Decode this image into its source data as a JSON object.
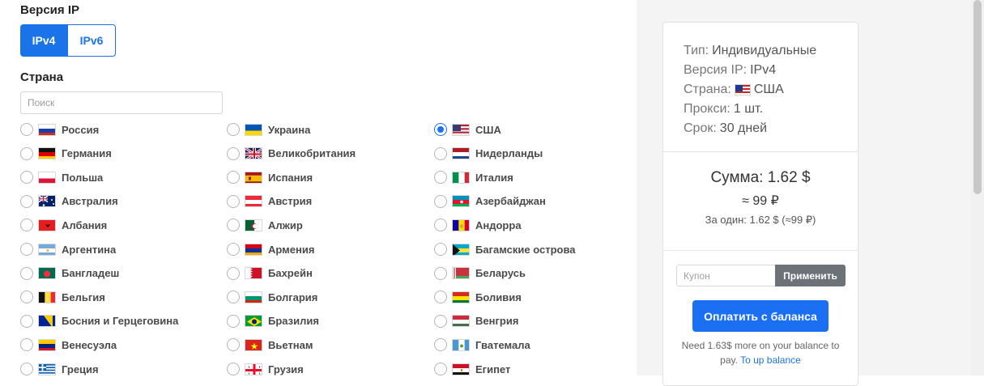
{
  "ip_version": {
    "label": "Версия IP",
    "options": [
      "IPv4",
      "IPv6"
    ],
    "selected": "IPv4"
  },
  "country_section": {
    "label": "Страна",
    "search_placeholder": "Поиск",
    "selected": "США"
  },
  "countries": [
    [
      "Россия",
      "Германия",
      "Польша",
      "Австралия",
      "Албания",
      "Аргентина",
      "Бангладеш",
      "Бельгия",
      "Босния и Герцеговина",
      "Венесуэла",
      "Греция"
    ],
    [
      "Украина",
      "Великобритания",
      "Испания",
      "Австрия",
      "Алжир",
      "Армения",
      "Бахрейн",
      "Болгария",
      "Бразилия",
      "Вьетнам",
      "Грузия"
    ],
    [
      "США",
      "Нидерланды",
      "Италия",
      "Азербайджан",
      "Андорра",
      "Багамские острова",
      "Беларусь",
      "Боливия",
      "Венгрия",
      "Гватемала",
      "Египет"
    ]
  ],
  "summary": {
    "type_label": "Тип:",
    "type_value": "Индивидуальные",
    "version_label": "Версия IP:",
    "version_value": "IPv4",
    "country_label": "Страна:",
    "country_value": "США",
    "proxy_label": "Прокси:",
    "proxy_value": "1 шт.",
    "term_label": "Срок:",
    "term_value": "30 дней",
    "total": "Сумма: 1.62 $",
    "total_rub": "≈ 99 ₽",
    "per_one": "За один: 1.62 $ (≈99 ₽)",
    "coupon_placeholder": "Купон",
    "apply_label": "Применить",
    "pay_label": "Оплатить с баланса",
    "need_text_1": "Need 1.63$ more on your balance to",
    "need_text_2": "pay.",
    "topup_label": "To up balance"
  },
  "colors": {
    "accent": "#1a73e8",
    "apply_button": "#6c7278",
    "page_background": "#f4f4f5"
  }
}
